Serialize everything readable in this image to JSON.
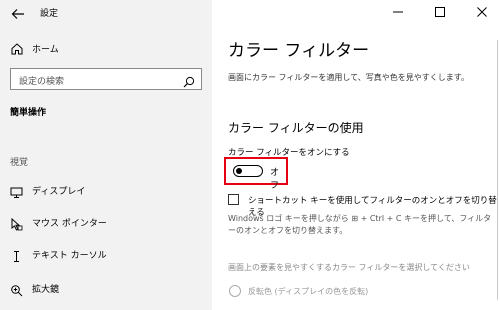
{
  "window": {
    "title": "設定"
  },
  "sidebar": {
    "home_label": "ホーム",
    "search_placeholder": "設定の検索",
    "section_title": "簡単操作",
    "group_title": "視覚",
    "items": [
      {
        "label": "ディスプレイ",
        "icon": "monitor-icon"
      },
      {
        "label": "マウス ポインター",
        "icon": "mouse-pointer-icon"
      },
      {
        "label": "テキスト カーソル",
        "icon": "text-cursor-icon"
      },
      {
        "label": "拡大鏡",
        "icon": "magnifier-icon"
      }
    ]
  },
  "main": {
    "title": "カラー フィルター",
    "description": "画面にカラー フィルターを適用して、写真や色を見やすくします。",
    "subheading": "カラー フィルターの使用",
    "toggle_caption": "カラー フィルターをオンにする",
    "toggle_state": "オフ",
    "toggle_on": false,
    "checkbox_label": "ショートカット キーを使用してフィルターのオンとオフを切り替える",
    "checkbox_checked": false,
    "hint": "Windows ロゴ キーを押しながら ⊞ + Ctrl + C キーを押して、フィルターのオンとオフを切り替えます。",
    "select_caption": "画面上の要素を見やすくするカラー フィルターを選択してください",
    "radio_label": "反転色 (ディスプレイの色を反転)"
  },
  "colors": {
    "sidebar_bg": "#f2f2f2",
    "highlight": "#e60012"
  }
}
